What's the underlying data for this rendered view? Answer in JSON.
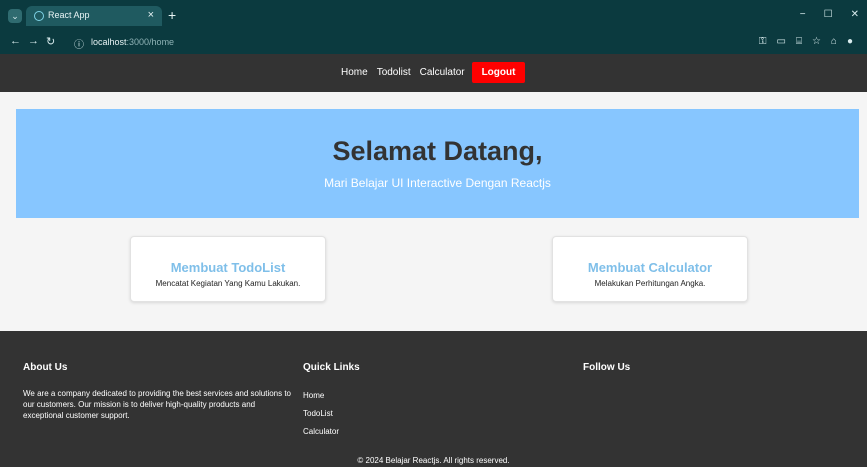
{
  "browser": {
    "tab_title": "React App",
    "tab_close": "×",
    "new_tab": "+",
    "url_host": "localhost",
    "url_path": ":3000/home",
    "window_controls": [
      "−",
      "☐",
      "✕"
    ]
  },
  "nav": {
    "links": [
      "Home",
      "Todolist",
      "Calculator"
    ],
    "logout_label": "Logout"
  },
  "hero": {
    "title": "Selamat Datang,",
    "subtitle": "Mari Belajar UI Interactive Dengan Reactjs"
  },
  "cards": [
    {
      "title": "Membuat TodoList",
      "description": "Mencatat Kegiatan Yang Kamu Lakukan."
    },
    {
      "title": "Membuat Calculator",
      "description": "Melakukan Perhitungan Angka."
    }
  ],
  "footer": {
    "about_heading": "About Us",
    "about_text": "We are a company dedicated to providing the best services and solutions to our customers. Our mission is to deliver high-quality products and exceptional customer support.",
    "quick_links_heading": "Quick Links",
    "quick_links": [
      "Home",
      "TodoList",
      "Calculator"
    ],
    "follow_heading": "Follow Us",
    "copyright": "© 2024 Belajar Reactjs. All rights reserved."
  },
  "colors": {
    "browser_chrome": "#0b3a3f",
    "nav_bg": "#333333",
    "logout_bg": "#ff0000",
    "hero_bg": "#87c6ff",
    "card_title": "#7fbfe9",
    "footer_bg": "#333333"
  }
}
